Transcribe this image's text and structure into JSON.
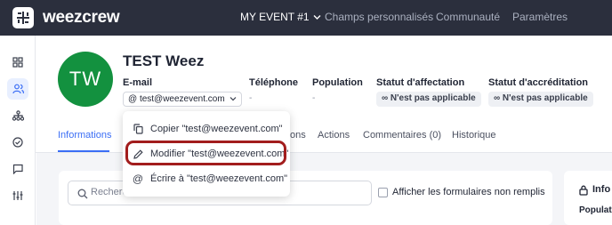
{
  "app": {
    "name": "weezcrew"
  },
  "nav": {
    "event_label": "MY EVENT #1",
    "items": [
      "Champs personnalisés",
      "Communauté",
      "Paramètres"
    ]
  },
  "sidebar": {
    "icons": [
      "dashboard-icon",
      "users-icon",
      "hierarchy-icon",
      "check-circle-icon",
      "chat-icon",
      "sliders-icon"
    ],
    "active": "users-icon"
  },
  "profile": {
    "initials": "TW",
    "name": "TEST Weez",
    "fields": [
      {
        "label": "E-mail",
        "value": "test@weezevent.com"
      },
      {
        "label": "Téléphone",
        "value": "-"
      },
      {
        "label": "Population",
        "value": "-"
      },
      {
        "label": "Statut d'affectation",
        "value": "N'est pas applicable"
      },
      {
        "label": "Statut d'accréditation",
        "value": "N'est pas applicable"
      }
    ]
  },
  "tabs": [
    {
      "label": "Informations",
      "active": true
    },
    {
      "label": "ons",
      "active": false
    },
    {
      "label": "Actions",
      "active": false
    },
    {
      "label": "Commentaires (0)",
      "active": false
    },
    {
      "label": "Historique",
      "active": false
    }
  ],
  "dropdown": {
    "items": [
      {
        "icon": "copy-icon",
        "label": "Copier \"test@weezevent.com\""
      },
      {
        "icon": "pencil-icon",
        "label": "Modifier \"test@weezevent.com\""
      },
      {
        "icon": "at-icon",
        "label": "Écrire à \"test@weezevent.com\""
      }
    ],
    "highlighted_index": 1
  },
  "content": {
    "search_text": "Recherc",
    "checkbox_label": "Afficher les formulaires non remplis",
    "checkbox_checked": false,
    "info_title": "Info",
    "population_label": "Populatio"
  },
  "colors": {
    "accent": "#3b6ef5",
    "topbar": "#2b2f3d",
    "avatar": "#13913f",
    "highlight": "#a21d1d"
  }
}
